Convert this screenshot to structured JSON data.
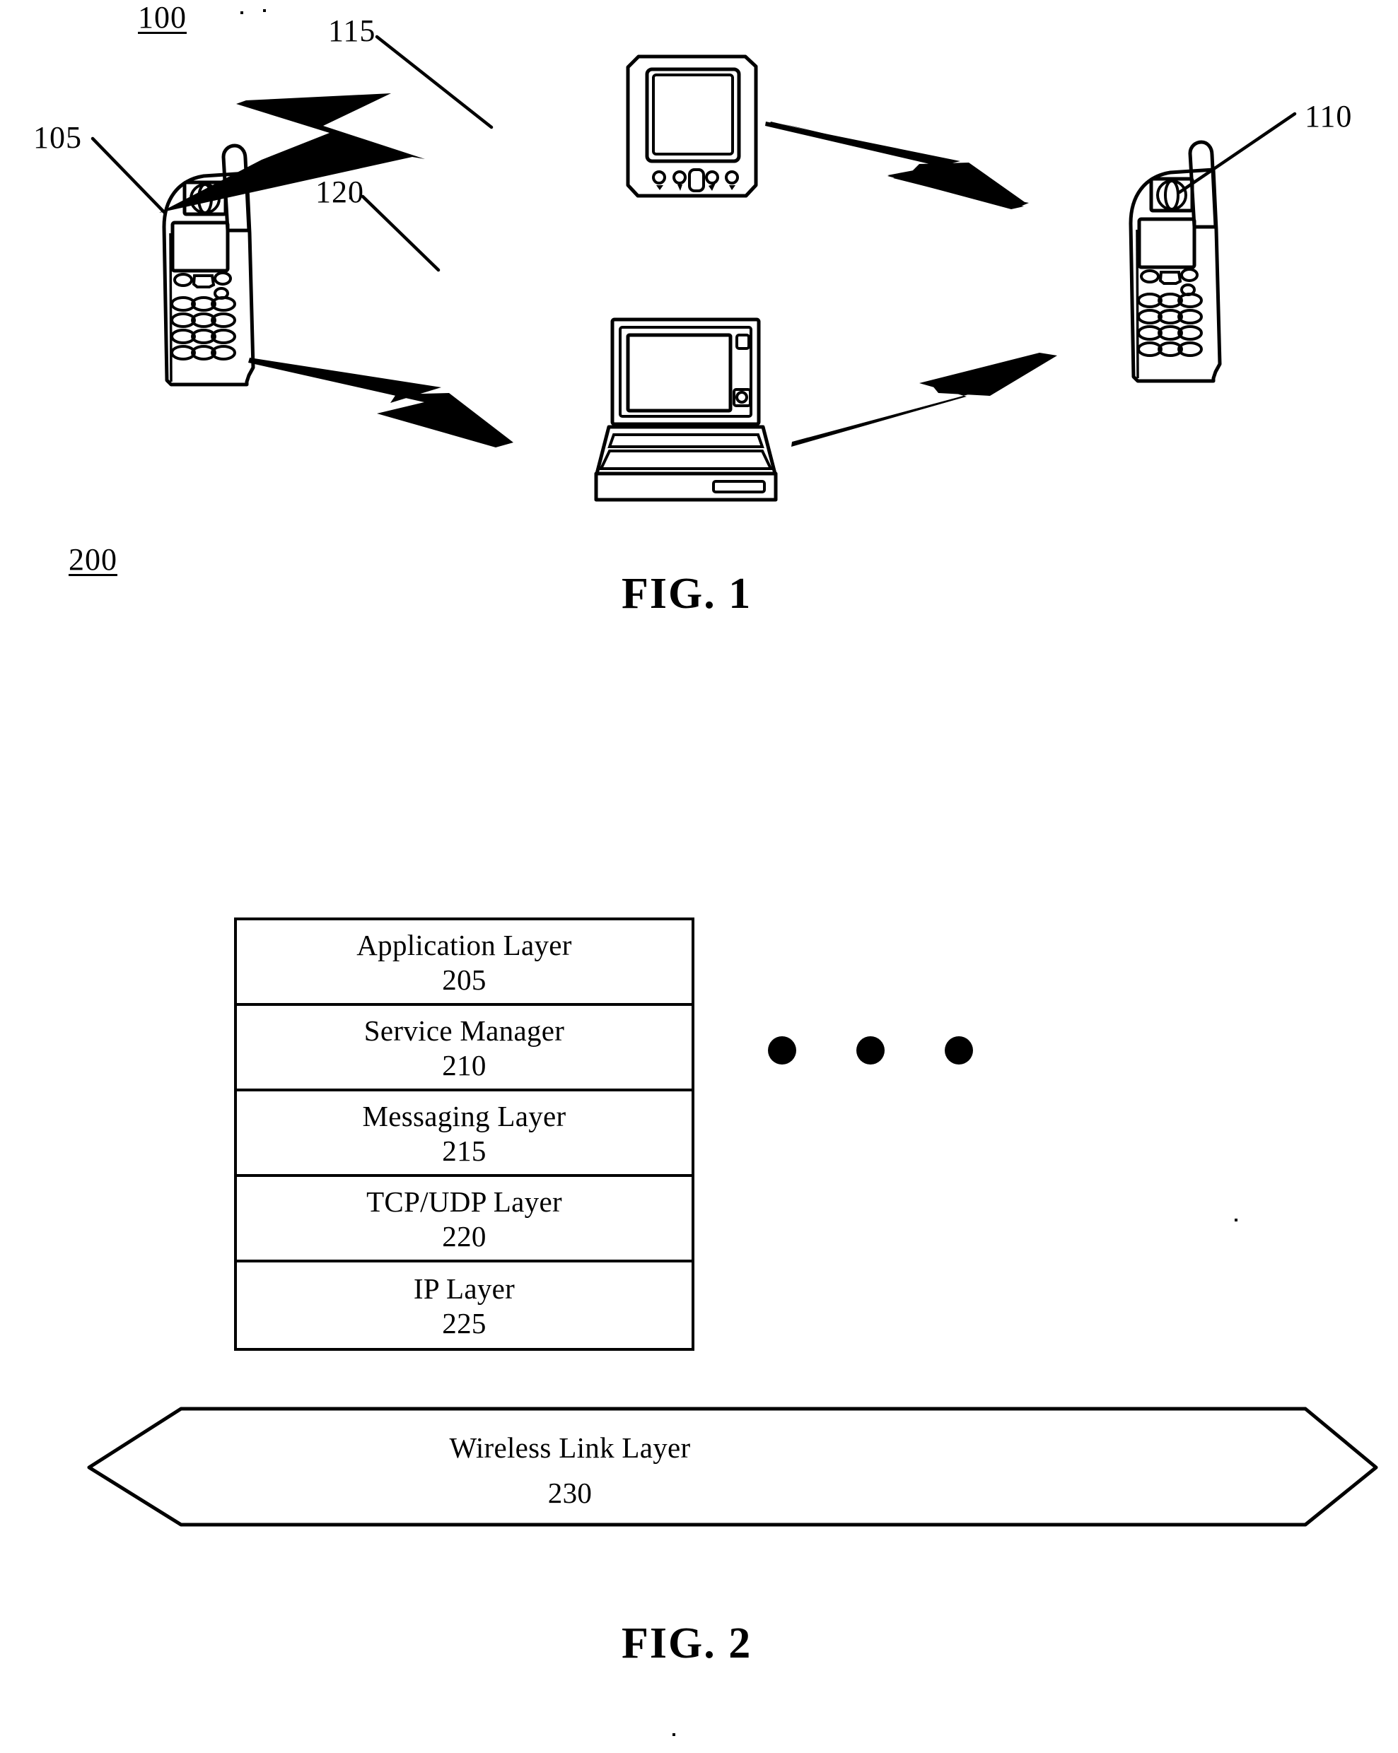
{
  "document": {
    "type": "patent-drawing-sheet",
    "background_color": "#ffffff",
    "ink_color": "#000000"
  },
  "figure1": {
    "caption": "FIG. 1",
    "system_label": "100",
    "nodes": [
      {
        "id": "105",
        "label": "105",
        "kind": "mobile-phone",
        "position": "left"
      },
      {
        "id": "110",
        "label": "110",
        "kind": "mobile-phone",
        "position": "right"
      },
      {
        "id": "115",
        "label": "115",
        "kind": "pda",
        "position": "top-center"
      },
      {
        "id": "120",
        "label": "120",
        "kind": "laptop-computer",
        "position": "bottom-center"
      }
    ],
    "links": [
      {
        "from": "105",
        "to": "115",
        "kind": "wireless-lightning"
      },
      {
        "from": "115",
        "to": "110",
        "kind": "wireless-lightning"
      },
      {
        "from": "105",
        "to": "120",
        "kind": "wireless-lightning"
      },
      {
        "from": "120",
        "to": "110",
        "kind": "wireless-lightning"
      }
    ]
  },
  "figure2": {
    "caption": "FIG. 2",
    "stack_label": "200",
    "layers": [
      {
        "name": "Application Layer",
        "number": "205"
      },
      {
        "name": "Service Manager",
        "number": "210"
      },
      {
        "name": "Messaging Layer",
        "number": "215"
      },
      {
        "name": "TCP/UDP Layer",
        "number": "220"
      },
      {
        "name": "IP Layer",
        "number": "225"
      }
    ],
    "ellipsis_dots": 3,
    "banner": {
      "name": "Wireless Link Layer",
      "number": "230"
    }
  }
}
